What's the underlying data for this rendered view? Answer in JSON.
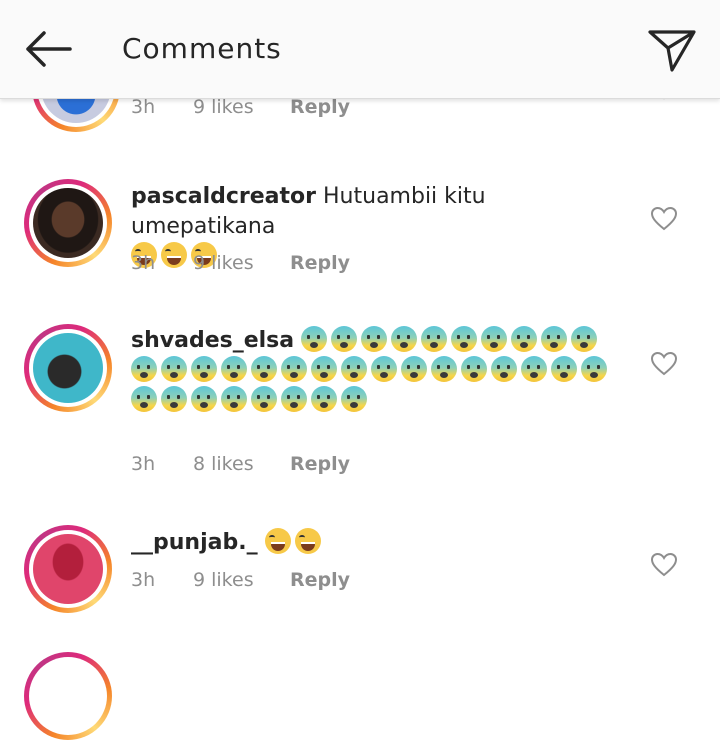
{
  "header": {
    "title": "Comments",
    "back_icon": "back-arrow-icon",
    "send_icon": "direct-send-icon"
  },
  "comments": [
    {
      "username": "",
      "text": "",
      "time": "3h",
      "likes": "9 likes",
      "reply": "Reply",
      "emoji": []
    },
    {
      "username": "pascaldcreator",
      "text": "Hutuambii kitu umepatikana",
      "time": "3h",
      "likes": "9 likes",
      "reply": "Reply",
      "emoji": [
        "face-with-tears-of-joy",
        "face-with-tears-of-joy",
        "face-with-tears-of-joy"
      ]
    },
    {
      "username": "shvades_elsa",
      "text": "",
      "time": "3h",
      "likes": "8 likes",
      "reply": "Reply",
      "emoji_count": 34,
      "emoji_name": "fearful-face"
    },
    {
      "username": "__punjab._",
      "text": "",
      "time": "3h",
      "likes": "9 likes",
      "reply": "Reply",
      "emoji": [
        "face-with-tears-of-joy",
        "face-with-tears-of-joy"
      ]
    }
  ],
  "colors": {
    "accent_ring_start": "#f58529",
    "accent_ring_end": "#dd2a7b",
    "meta_text": "#8e8e8e"
  }
}
